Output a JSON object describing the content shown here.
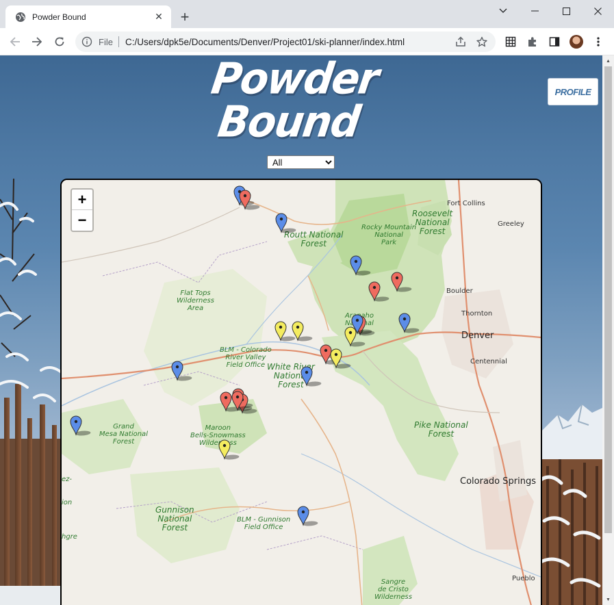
{
  "browser": {
    "tab_title": "Powder Bound",
    "omnibox_scheme": "File",
    "url": "C:/Users/dpk5e/Documents/Denver/Project01/ski-planner/index.html"
  },
  "header": {
    "title": "Powder Bound",
    "profile_label": "PROFILE"
  },
  "filter": {
    "selected": "All"
  },
  "map": {
    "zoom_in": "+",
    "zoom_out": "−",
    "labels": {
      "routt": "Routt National\nForest",
      "rocky": "Rocky Mountain\nNational\nPark",
      "roosevelt": "Roosevelt\nNational\nForest",
      "flattops": "Flat Tops\nWilderness\nArea",
      "arapaho": "Arapaho\nNational\nFo",
      "blm_colorado": "BLM - Colorado\nRiver Valley\nField Office",
      "white_river": "White River\nNational\nForest",
      "grand_mesa": "Grand\nMesa National\nForest",
      "maroon": "Maroon\nBells-Snowmass\nWilderness",
      "pike": "Pike National\nForest",
      "gunnison": "Gunnison\nNational\nForest",
      "blm_gunnison": "BLM - Gunnison\nField Office",
      "sangre": "Sangre\nde Cristo\nWilderness",
      "fort_collins": "Fort Collins",
      "greeley": "Greeley",
      "boulder": "Boulder",
      "thornton": "Thornton",
      "denver": "Denver",
      "centennial": "Centennial",
      "colorado_springs": "Colorado Springs",
      "pueblo": "Pueblo",
      "edge1": "ez-",
      "edge2": "ion",
      "edge3": "hgre"
    },
    "marker_colors": {
      "blue": "#5b8de8",
      "red": "#ef6b5f",
      "yellow": "#f4ec5f"
    },
    "markers": [
      {
        "color": "blue"
      },
      {
        "color": "red"
      },
      {
        "color": "blue"
      },
      {
        "color": "blue"
      },
      {
        "color": "red"
      },
      {
        "color": "red"
      },
      {
        "color": "blue"
      },
      {
        "color": "red"
      },
      {
        "color": "blue"
      },
      {
        "color": "yellow"
      },
      {
        "color": "yellow"
      },
      {
        "color": "yellow"
      },
      {
        "color": "red"
      },
      {
        "color": "yellow"
      },
      {
        "color": "blue"
      },
      {
        "color": "blue"
      },
      {
        "color": "red"
      },
      {
        "color": "red"
      },
      {
        "color": "red"
      },
      {
        "color": "red"
      },
      {
        "color": "blue"
      },
      {
        "color": "yellow"
      },
      {
        "color": "blue"
      }
    ]
  }
}
